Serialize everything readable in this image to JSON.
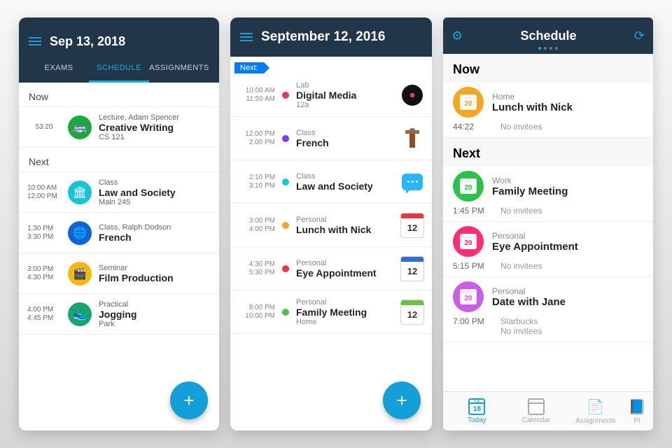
{
  "colors": {
    "blue": "#139fd7",
    "header": "#223649"
  },
  "phone1": {
    "date": "Sep 13, 2018",
    "tabs": [
      "EXAMS",
      "SCHEDULE",
      "ASSIGNMENTS"
    ],
    "active_tab": 1,
    "sections": {
      "now": "Now",
      "next": "Next"
    },
    "now_item": {
      "countdown": "53:20",
      "over": "Lecture, Adam Spencer",
      "title": "Creative Writing",
      "under": "CS 121",
      "icon_color": "#1aaa3a"
    },
    "next_items": [
      {
        "start": "10:00 AM",
        "end": "12:00 PM",
        "over": "Class",
        "title": "Law and Society",
        "under": "Main 245",
        "icon_color": "#18c3d6"
      },
      {
        "start": "1:30 PM",
        "end": "3:30 PM",
        "over": "Class, Ralph Dodson",
        "title": "French",
        "under": "",
        "icon_color": "#1262d6"
      },
      {
        "start": "3:00 PM",
        "end": "4:30 PM",
        "over": "Seminar",
        "title": "Film Production",
        "under": "",
        "icon_color": "#f4b90c"
      },
      {
        "start": "4:00 PM",
        "end": "4:45 PM",
        "over": "Practical",
        "title": "Jogging",
        "under": "Park",
        "icon_color": "#15a571"
      }
    ]
  },
  "phone2": {
    "date": "September 12, 2016",
    "next_chip": "Next:",
    "items": [
      {
        "start": "10:00 AM",
        "end": "11:50 AM",
        "over": "Lab",
        "title": "Digital Media",
        "under": "12a",
        "dot": "#e83556",
        "right": "vinyl"
      },
      {
        "start": "12:00 PM",
        "end": "2:00 PM",
        "over": "Class",
        "title": "French",
        "under": "",
        "dot": "#7b3ff0",
        "right": "podium"
      },
      {
        "start": "2:10 PM",
        "end": "3:10 PM",
        "over": "Class",
        "title": "Law and Society",
        "under": "",
        "dot": "#19c5e5",
        "right": "chat"
      },
      {
        "start": "3:00 PM",
        "end": "4:00 PM",
        "over": "Personal",
        "title": "Lunch with Nick",
        "under": "",
        "dot": "#f5a623",
        "right": "cal",
        "cal_color": "#e83a3a",
        "cal_num": "12"
      },
      {
        "start": "4:30 PM",
        "end": "5:30 PM",
        "over": "Personal",
        "title": "Eye Appointment",
        "under": "",
        "dot": "#e83556",
        "right": "cal",
        "cal_color": "#2c6fd6",
        "cal_num": "12"
      },
      {
        "start": "8:00 PM",
        "end": "10:00 PM",
        "over": "Personal",
        "title": "Family Meeting",
        "under": "Home",
        "dot": "#4cc24c",
        "right": "cal",
        "cal_color": "#6fbf44",
        "cal_num": "12"
      }
    ]
  },
  "phone3": {
    "title": "Schedule",
    "sections": {
      "now": "Now",
      "next": "Next"
    },
    "now": {
      "over": "Home",
      "title": "Lunch with Nick",
      "time": "44:22",
      "sub": "No invitees",
      "color": "#f5a623",
      "num": "20"
    },
    "next": [
      {
        "over": "Work",
        "title": "Family Meeting",
        "time": "1:45 PM",
        "sub": "No invitees",
        "color": "#2bc24a",
        "num": "20"
      },
      {
        "over": "Personal",
        "title": "Eye Appointment",
        "time": "5:15 PM",
        "sub": "No invitees",
        "color": "#ff2d72",
        "num": "20"
      },
      {
        "over": "Personal",
        "title": "Date with Jane",
        "time": "7:00 PM",
        "sub": "Starbucks\nNo invitees",
        "color": "#c85fe6",
        "num": "20"
      }
    ],
    "tabbar": [
      {
        "label": "Today",
        "num": "18",
        "top": "TUE",
        "active": true
      },
      {
        "label": "Calendar"
      },
      {
        "label": "Assignments"
      },
      {
        "label": "Pl"
      }
    ]
  }
}
